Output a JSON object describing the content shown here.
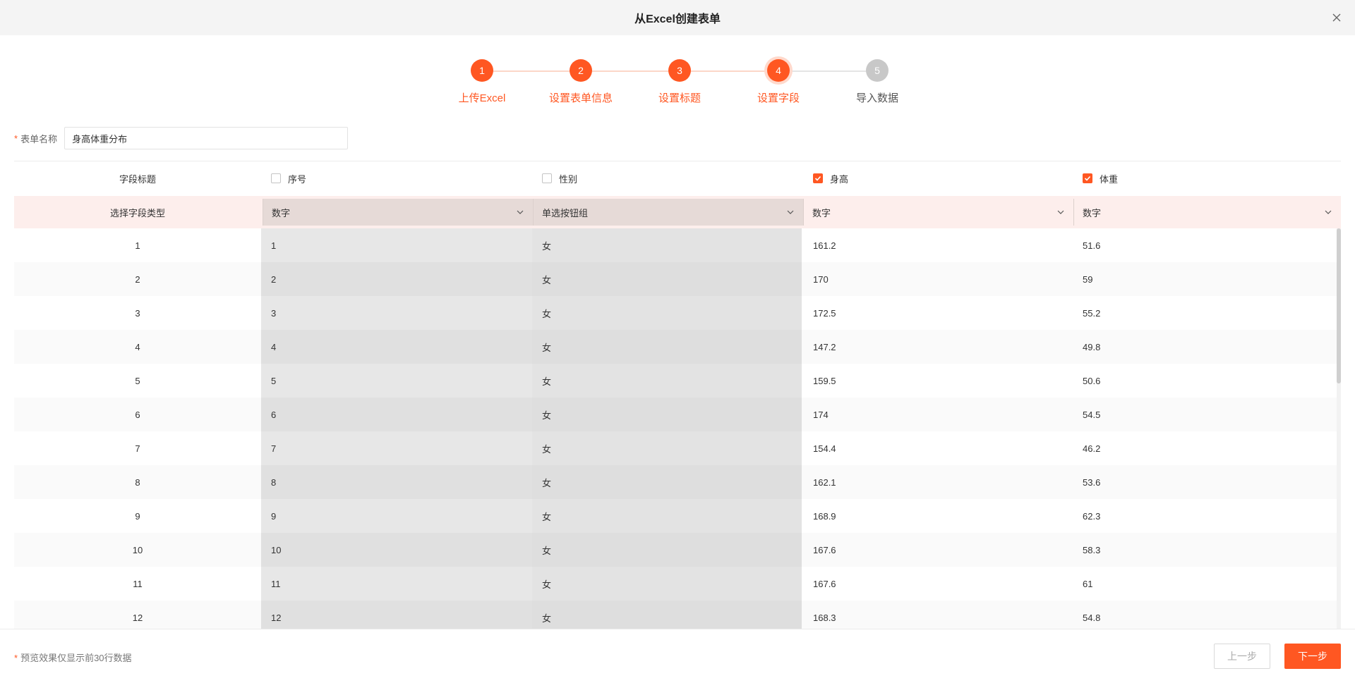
{
  "dialog": {
    "title": "从Excel创建表单"
  },
  "steps": [
    {
      "num": "1",
      "label": "上传Excel",
      "state": "active"
    },
    {
      "num": "2",
      "label": "设置表单信息",
      "state": "active"
    },
    {
      "num": "3",
      "label": "设置标题",
      "state": "active"
    },
    {
      "num": "4",
      "label": "设置字段",
      "state": "current"
    },
    {
      "num": "5",
      "label": "导入数据",
      "state": "todo"
    }
  ],
  "form": {
    "required_mark": "*",
    "name_label": "表单名称",
    "name_value": "身高体重分布"
  },
  "table": {
    "header_label": "字段标题",
    "type_label": "选择字段类型",
    "columns": [
      {
        "title": "序号",
        "checked": false,
        "type": "数字"
      },
      {
        "title": "性别",
        "checked": false,
        "type": "单选按钮组"
      },
      {
        "title": "身高",
        "checked": true,
        "type": "数字"
      },
      {
        "title": "体重",
        "checked": true,
        "type": "数字"
      }
    ],
    "rows": [
      [
        "1",
        "1",
        "女",
        "161.2",
        "51.6"
      ],
      [
        "2",
        "2",
        "女",
        "170",
        "59"
      ],
      [
        "3",
        "3",
        "女",
        "172.5",
        "55.2"
      ],
      [
        "4",
        "4",
        "女",
        "147.2",
        "49.8"
      ],
      [
        "5",
        "5",
        "女",
        "159.5",
        "50.6"
      ],
      [
        "6",
        "6",
        "女",
        "174",
        "54.5"
      ],
      [
        "7",
        "7",
        "女",
        "154.4",
        "46.2"
      ],
      [
        "8",
        "8",
        "女",
        "162.1",
        "53.6"
      ],
      [
        "9",
        "9",
        "女",
        "168.9",
        "62.3"
      ],
      [
        "10",
        "10",
        "女",
        "167.6",
        "58.3"
      ],
      [
        "11",
        "11",
        "女",
        "167.6",
        "61"
      ],
      [
        "12",
        "12",
        "女",
        "168.3",
        "54.8"
      ]
    ]
  },
  "footer": {
    "note": "预览效果仅显示前30行数据",
    "prev_label": "上一步",
    "next_label": "下一步"
  },
  "colors": {
    "accent": "#ff5722",
    "todo": "#c8c8c8"
  }
}
